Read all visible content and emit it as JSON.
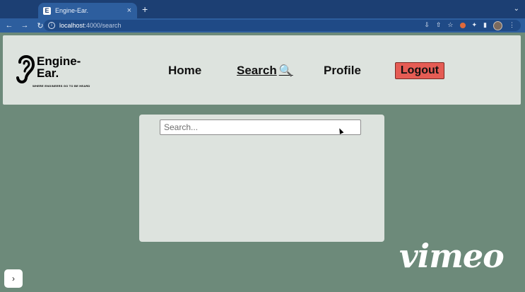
{
  "browser": {
    "tab_title": "Engine-Ear.",
    "tab_close": "×",
    "new_tab": "+",
    "tab_menu": "⌄",
    "back": "←",
    "forward": "→",
    "reload": "↻",
    "url_host": "localhost",
    "url_path": ":4000/search"
  },
  "logo": {
    "line1": "Engine-",
    "line2": "Ear.",
    "tagline": "WHERE ENGINEERS GO TO BE HEARD"
  },
  "nav": {
    "home": "Home",
    "search": "Search",
    "search_icon": "🔍",
    "profile": "Profile",
    "logout": "Logout"
  },
  "search": {
    "placeholder": "Search..."
  },
  "watermark": "vimeo",
  "side_button": "›",
  "colors": {
    "background": "#6d8a7a",
    "card": "#dde3de",
    "logout": "#e55c54",
    "chrome": "#2d5e9e"
  }
}
